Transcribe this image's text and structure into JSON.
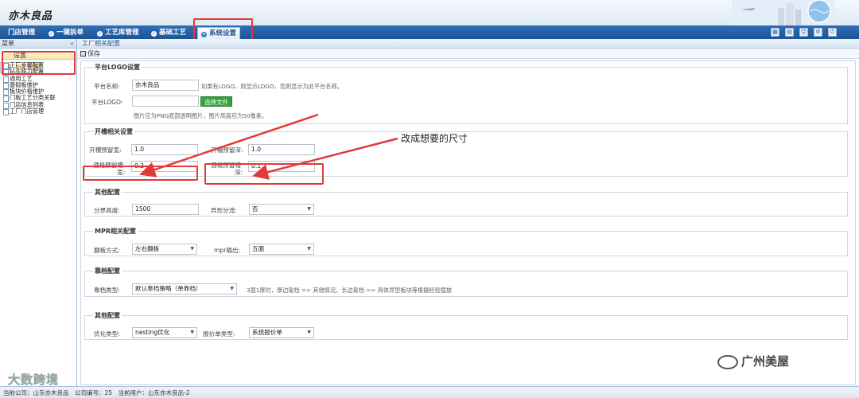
{
  "app": {
    "logo": "亦木良品"
  },
  "nav": {
    "tabs": [
      {
        "label": "门店管理"
      },
      {
        "label": "一键拆单"
      },
      {
        "label": "工艺库管理"
      },
      {
        "label": "基础工艺"
      },
      {
        "label": "系统设置"
      }
    ]
  },
  "toolbar_icons": [
    "calendar-icon",
    "document-icon",
    "user-icon",
    "gear-icon",
    "exit-icon"
  ],
  "sidebar": {
    "header": "菜单",
    "collapse_glyph": "«",
    "group": "设置",
    "items": [
      {
        "label": "工厂相关配置"
      },
      {
        "label": "工厂步骤配置"
      },
      {
        "label": "钻头铣刀配置"
      },
      {
        "label": "通用工艺"
      },
      {
        "label": "基础板维护"
      },
      {
        "label": "板块价格维护"
      },
      {
        "label": "门板工艺分类关联"
      },
      {
        "label": "门店信息列表"
      },
      {
        "label": "工厂门店管理"
      }
    ]
  },
  "breadcrumb": "工厂相关配置",
  "save_label": "保存",
  "platform": {
    "legend": "平台LOGO设置",
    "name_label": "平台名称:",
    "name_value": "亦木良品",
    "name_hint": "如果有LOGO，则显示LOGO，否则显示为此平台名称。",
    "logo_label": "平台LOGO:",
    "file_button": "选择文件",
    "logo_hint": "图片应为PNG底部透明图片，图片高度应为50像素。"
  },
  "groove": {
    "legend": "开槽相关设置",
    "width_label": "开槽预留宽:",
    "width_value": "1.0",
    "depth_label": "开槽预留深:",
    "depth_value": "1.0",
    "wine_width_label_1": "酒格预留槽",
    "wine_width_label_2": "宽:",
    "wine_width_value": "0.2",
    "wine_depth_label_1": "酒格预留槽",
    "wine_depth_label_2": "深:",
    "wine_depth_value": "0.1"
  },
  "other1": {
    "legend": "其他配置",
    "split_label": "分界高度:",
    "split_value": "1500",
    "shape_label": "异形分流:",
    "shape_value": "否"
  },
  "mpr": {
    "legend": "MPR相关配置",
    "flip_label": "翻板方式:",
    "flip_value": "左右翻板",
    "output_label": "mpr输出:",
    "output_value": "五面"
  },
  "edge": {
    "legend": "靠档配置",
    "type_label": "靠档类型:",
    "type_value": "默认靠档策略（单靠档）",
    "hint": "3面1厚时，厚边靠档 => 其他情况，长边靠档 => 具体异型板块等根据经验摆放"
  },
  "other2": {
    "legend": "其他配置",
    "opt_label": "优化类型:",
    "opt_value": "nesting优化",
    "quote_label": "报价单类型:",
    "quote_value": "系统报价单"
  },
  "annotation": "改成想要的尺寸",
  "footer": "当前公司：山东亦木良品　公司编号：25　当前用户：山东亦木良品-2",
  "watermarks": {
    "left": "大数跨境",
    "right": "广州美屋"
  },
  "colors": {
    "nav": "#1d5496",
    "highlight": "#e23a3a",
    "file_button": "#36a13e"
  }
}
